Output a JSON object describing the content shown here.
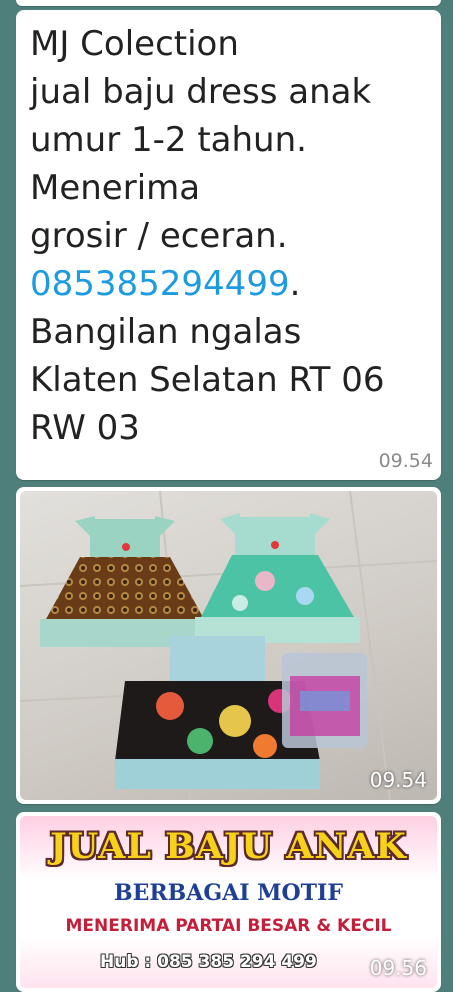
{
  "message": {
    "lines": [
      "MJ Colection",
      "jual baju dress anak",
      "umur 1-2 tahun.",
      "Menerima",
      "grosir / eceran.",
      "085385294499",
      ".",
      "Bangilan ngalas",
      "Klaten Selatan RT 06",
      "RW 03"
    ],
    "time": "09.54"
  },
  "photo": {
    "time": "09.54"
  },
  "banner": {
    "title": "JUAL BAJU ANAK",
    "subtitle": "BERBAGAI MOTIF",
    "subtitle2": "MENERIMA PARTAI BESAR & KECIL",
    "hub": "Hub : 085 385 294 499",
    "time": "09.56"
  }
}
